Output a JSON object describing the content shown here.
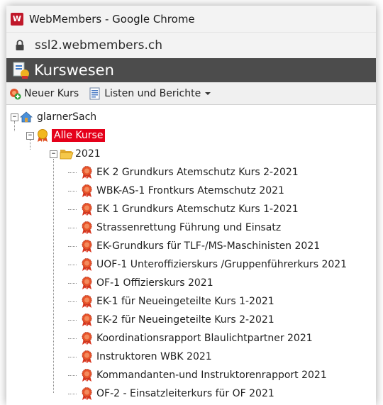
{
  "window": {
    "title": "WebMembers - Google Chrome",
    "logo_text": "W"
  },
  "address": {
    "url": "ssl2.webmembers.ch"
  },
  "header": {
    "title": "Kurswesen"
  },
  "toolbar": {
    "new_course": "Neuer Kurs",
    "reports": "Listen und Berichte"
  },
  "tree": {
    "root": "glarnerSach",
    "all_courses": "Alle Kurse",
    "year": "2021",
    "courses": [
      "EK 2 Grundkurs Atemschutz Kurs 2-2021",
      "WBK-AS-1 Frontkurs Atemschutz 2021",
      "EK 1 Grundkurs Atemschutz Kurs 1-2021",
      "Strassenrettung Führung und Einsatz",
      "EK-Grundkurs für TLF-/MS-Maschinisten 2021",
      "UOF-1 Unteroffizierskurs /Gruppenführerkurs 2021",
      "OF-1 Offizierskurs 2021",
      "EK-1 für Neueingeteilte Kurs 1-2021",
      "EK-2 für Neueingeteilte Kurs 2-2021",
      "Koordinationsrapport Blaulichtpartner 2021",
      "Instruktoren WBK 2021",
      "Kommandanten-und Instruktorenrapport 2021",
      "OF-2 - Einsatzleiterkurs für OF 2021"
    ]
  },
  "colors": {
    "selected_bg": "#e5001a",
    "header_bg": "#4c4c4c"
  }
}
